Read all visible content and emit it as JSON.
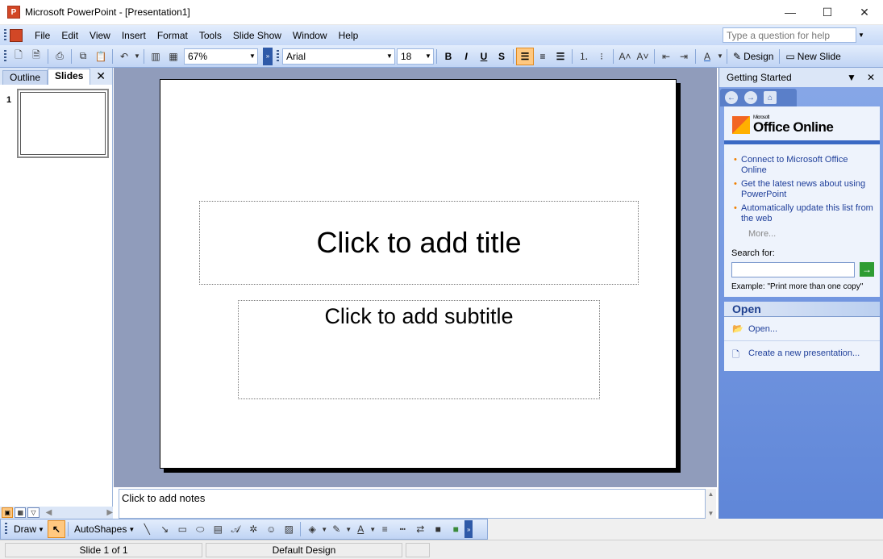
{
  "window": {
    "title": "Microsoft PowerPoint - [Presentation1]",
    "minimize": "—",
    "maximize": "☐",
    "close": "✕"
  },
  "menubar": {
    "items": [
      "File",
      "Edit",
      "View",
      "Insert",
      "Format",
      "Tools",
      "Slide Show",
      "Window",
      "Help"
    ],
    "help_placeholder": "Type a question for help"
  },
  "toolbar": {
    "zoom": "67%",
    "font": "Arial",
    "font_size": "18",
    "bold": "B",
    "italic": "I",
    "underline": "U",
    "shadow": "S",
    "design_label": "Design",
    "new_slide_label": "New Slide"
  },
  "slides_pane": {
    "tabs": [
      "Outline",
      "Slides"
    ],
    "active_tab": "Slides",
    "close": "✕",
    "slide_number": "1"
  },
  "slide": {
    "title_placeholder": "Click to add title",
    "subtitle_placeholder": "Click to add subtitle"
  },
  "notes": {
    "placeholder": "Click to add notes"
  },
  "task_pane": {
    "title": "Getting Started",
    "logo_ms": "Microsoft",
    "logo_text": "Office Online",
    "links": [
      "Connect to Microsoft Office Online",
      "Get the latest news about using PowerPoint",
      "Automatically update this list from the web"
    ],
    "more": "More...",
    "search_label": "Search for:",
    "example": "Example:  \"Print more than one copy\"",
    "open_heading": "Open",
    "open_link": "Open...",
    "new_presentation": "Create a new presentation..."
  },
  "drawbar": {
    "draw_label": "Draw",
    "autoshapes_label": "AutoShapes"
  },
  "status": {
    "slide_info": "Slide 1 of 1",
    "design": "Default Design"
  },
  "colors": {
    "accent": "#d24726",
    "toolbar_top": "#e3edfc",
    "toolbar_bottom": "#c0d4f4",
    "task_pane": "#5f86d8",
    "link": "#1f3f9a",
    "active_button": "#ffc880"
  }
}
